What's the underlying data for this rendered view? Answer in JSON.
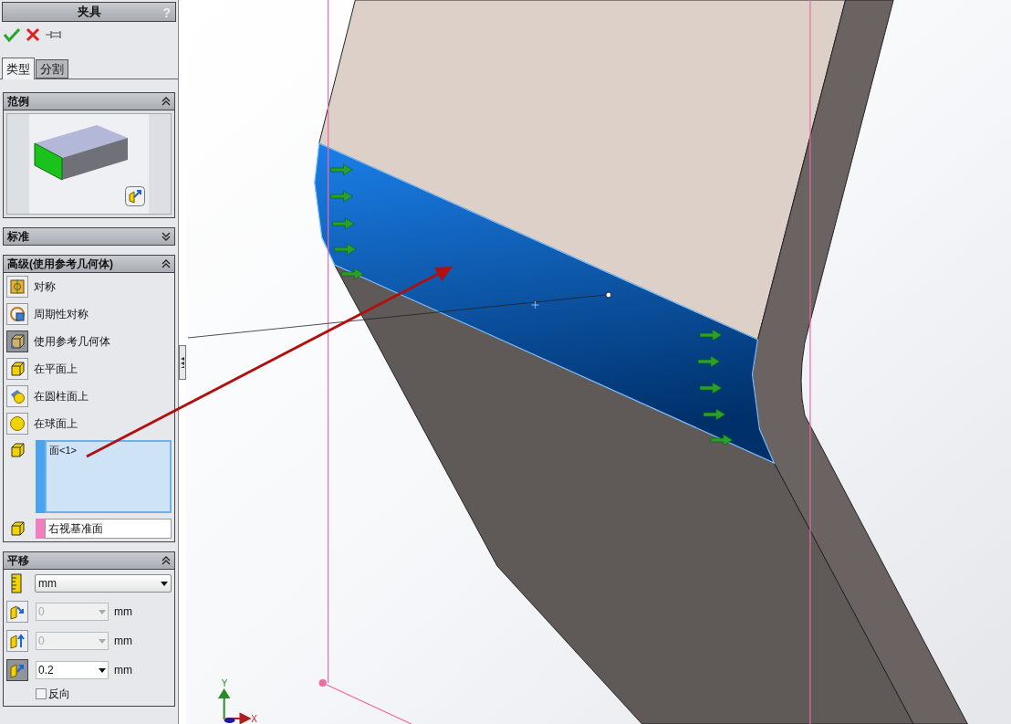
{
  "panel": {
    "title": "夹具",
    "help": "?"
  },
  "tabs": [
    {
      "label": "类型",
      "selected": true
    },
    {
      "label": "分割",
      "selected": false
    }
  ],
  "example": {
    "title": "范例",
    "expanded": true
  },
  "standard": {
    "title": "标准",
    "expanded": false
  },
  "advanced": {
    "title": "高级(使用参考几何体)",
    "expanded": true,
    "options": [
      {
        "label": "对称",
        "selected": false,
        "kind": "symmetry"
      },
      {
        "label": "周期性对称",
        "selected": false,
        "kind": "cyclic"
      },
      {
        "label": "使用参考几何体",
        "selected": true,
        "kind": "reference"
      },
      {
        "label": "在平面上",
        "selected": false,
        "kind": "plane"
      },
      {
        "label": "在圆柱面上",
        "selected": false,
        "kind": "cylinder"
      },
      {
        "label": "在球面上",
        "selected": false,
        "kind": "sphere"
      }
    ],
    "faces": [
      "面<1>"
    ],
    "reference": "右视基准面"
  },
  "translate": {
    "title": "平移",
    "expanded": true,
    "unit": "mm",
    "rows": [
      {
        "value": "0",
        "unit": "mm",
        "disabled": true,
        "selected": false
      },
      {
        "value": "0",
        "unit": "mm",
        "disabled": true,
        "selected": false
      },
      {
        "value": "0.2",
        "unit": "mm",
        "disabled": false,
        "selected": true
      }
    ],
    "reverse": {
      "label": "反向",
      "checked": false
    }
  },
  "axes": {
    "x": "X",
    "y": "Y"
  }
}
